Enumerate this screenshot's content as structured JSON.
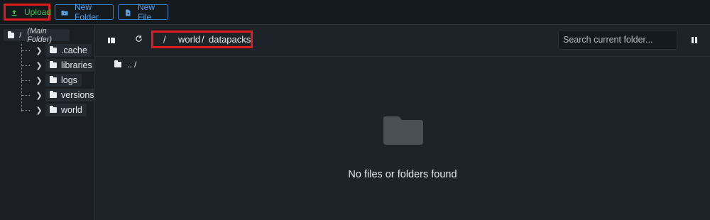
{
  "toolbar": {
    "upload_label": "Upload",
    "new_folder_label": "New Folder",
    "new_file_label": "New File"
  },
  "tree": {
    "root_path": "/",
    "root_label": "(Main Folder)",
    "items": [
      {
        "label": ".cache"
      },
      {
        "label": "libraries"
      },
      {
        "label": "logs"
      },
      {
        "label": "versions"
      },
      {
        "label": "world"
      }
    ]
  },
  "breadcrumb": {
    "root": "/",
    "segments": [
      "world",
      "datapacks"
    ],
    "separator": "/"
  },
  "search": {
    "placeholder": "Search current folder..."
  },
  "listing": {
    "parent_label": ".. /",
    "empty_message": "No files or folders found"
  },
  "colors": {
    "accent": "#3b7fc4",
    "upload_text": "#3fbf4a",
    "highlight": "#e01b1b",
    "background": "#1b1f24"
  }
}
